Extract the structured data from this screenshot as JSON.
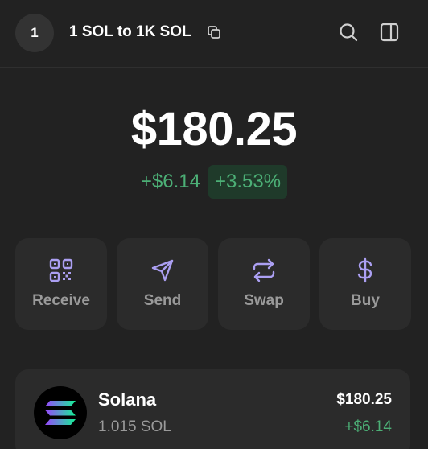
{
  "header": {
    "account_index": "1",
    "account_name": "1 SOL to 1K SOL",
    "icons": [
      "copy-icon",
      "search-icon",
      "side-panel-icon"
    ]
  },
  "balance": {
    "total": "$180.25",
    "change_abs": "+$6.14",
    "change_pct": "+3.53%"
  },
  "actions": [
    {
      "label": "Receive",
      "icon": "qr-code-icon"
    },
    {
      "label": "Send",
      "icon": "send-icon"
    },
    {
      "label": "Swap",
      "icon": "swap-icon"
    },
    {
      "label": "Buy",
      "icon": "dollar-icon"
    }
  ],
  "tokens": [
    {
      "name": "Solana",
      "amount": "1.015 SOL",
      "value": "$180.25",
      "change": "+$6.14",
      "icon": "solana-logo-icon"
    }
  ],
  "colors": {
    "background": "#222222",
    "card": "#2b2b2b",
    "accent": "#ab9ff2",
    "positive": "#4caf76",
    "muted": "#9a9a9a"
  }
}
